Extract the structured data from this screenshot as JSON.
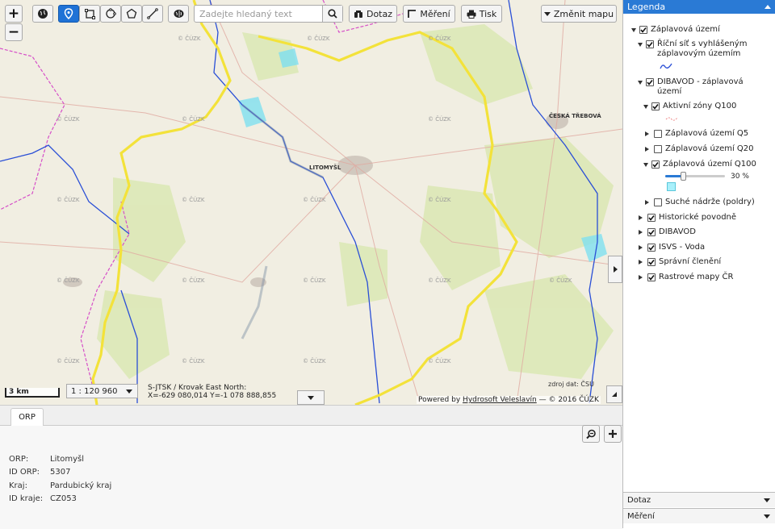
{
  "map": {
    "search_placeholder": "Zadejte hledaný text",
    "buttons": {
      "dotaz": "Dotaz",
      "mereni": "Měření",
      "tisk": "Tisk",
      "zmenit_mapu": "Změnit mapu"
    },
    "scale_bar": "3 km",
    "scale_value": "1 : 120 960",
    "coords_line1": "S-JTSK / Krovak East North:",
    "coords_line2": "X=-629 080,014 Y=-1 078 888,855",
    "source": "zdroj dat: ČSÚ",
    "credits_prefix": "Powered by",
    "credits_link": "Hydrosoft Veleslavín",
    "credits_suffix": "— © 2016 ČÚZK",
    "watermark": "© ČÚZK",
    "place_labels": [
      "LITOMYŠL",
      "ČESKÁ TŘEBOVÁ"
    ]
  },
  "legend": {
    "title": "Legenda",
    "items": [
      {
        "label": "Záplavová území",
        "checked": true,
        "expanded": true
      },
      {
        "label": "Říční síť s vyhlášeným záplavovým územím",
        "checked": true,
        "expanded": true
      },
      {
        "label": "DIBAVOD - záplavová území",
        "checked": true,
        "expanded": true
      },
      {
        "label": "Aktivní zóny Q100",
        "checked": true,
        "expanded": true
      },
      {
        "label": "Záplavová území Q5",
        "checked": false,
        "expanded": false
      },
      {
        "label": "Záplavová území Q20",
        "checked": false,
        "expanded": false
      },
      {
        "label": "Záplavová území Q100",
        "checked": true,
        "expanded": true
      },
      {
        "label": "Suché nádrže (poldry)",
        "checked": false,
        "expanded": false
      },
      {
        "label": "Historické povodně",
        "checked": true,
        "expanded": false
      },
      {
        "label": "DIBAVOD",
        "checked": true,
        "expanded": false
      },
      {
        "label": "ISVS - Voda",
        "checked": true,
        "expanded": false
      },
      {
        "label": "Správní členění",
        "checked": true,
        "expanded": false
      },
      {
        "label": "Rastrové mapy ČR",
        "checked": true,
        "expanded": false
      }
    ],
    "opacity": {
      "value_label": "30 %",
      "fraction": 0.3
    },
    "accordion": {
      "dotaz": "Dotaz",
      "mereni": "Měření"
    }
  },
  "bottom": {
    "tab": "ORP",
    "info": [
      {
        "key": "ORP:",
        "value": "Litomyšl"
      },
      {
        "key": "ID ORP:",
        "value": "5307"
      },
      {
        "key": "Kraj:",
        "value": "Pardubický kraj"
      },
      {
        "key": "ID kraje:",
        "value": "CZ053"
      }
    ]
  },
  "colors": {
    "accent": "#2a7ad5",
    "boundary": "#f3e23a",
    "river": "#2a4fd6",
    "flood": "#7fe0f0"
  }
}
